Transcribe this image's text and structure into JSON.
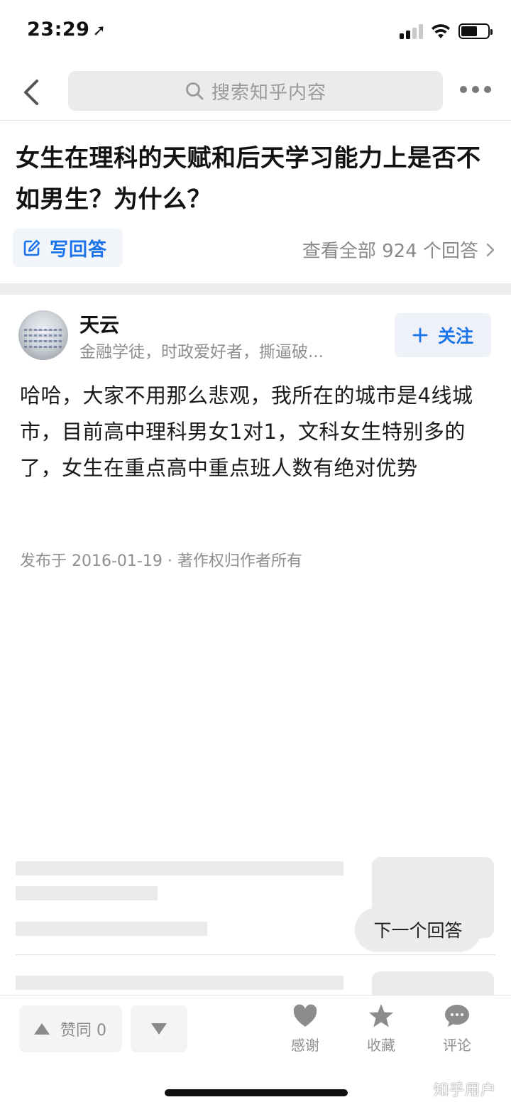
{
  "status_bar": {
    "time": "23:29",
    "location_glyph": "➚"
  },
  "nav": {
    "search_placeholder": "搜索知乎内容"
  },
  "question": {
    "title": "女生在理科的天赋和后天学习能力上是否不如男生？为什么？",
    "write_answer_label": "写回答",
    "view_all_label": "查看全部 924 个回答"
  },
  "answer": {
    "author_name": "天云",
    "author_bio": "金融学徒，时政爱好者，撕逼破...",
    "follow_label": "关注",
    "content": "哈哈，大家不用那么悲观，我所在的城市是4线城市，目前高中理科男女1对1，文科女生特别多的了，女生在重点高中重点班人数有绝对优势",
    "publish_info": "发布于 2016-01-19 · 著作权归作者所有"
  },
  "next_answer_label": "下一个回答",
  "bottom_bar": {
    "upvote_label": "赞同 0",
    "thanks_label": "感谢",
    "collect_label": "收藏",
    "comment_label": "评论",
    "watermark": "知乎用户"
  },
  "colors": {
    "accent": "#1a73e8",
    "muted": "#8f8f8f",
    "skeleton": "#ebebeb"
  },
  "icons": [
    "location-arrow-icon",
    "cellular-signal-icon",
    "wifi-icon",
    "battery-icon",
    "back-arrow-icon",
    "search-icon",
    "more-dots-icon",
    "edit-icon",
    "chevron-right-icon",
    "plus-icon",
    "triangle-up-icon",
    "triangle-down-icon",
    "heart-icon",
    "star-icon",
    "speech-bubble-icon"
  ]
}
